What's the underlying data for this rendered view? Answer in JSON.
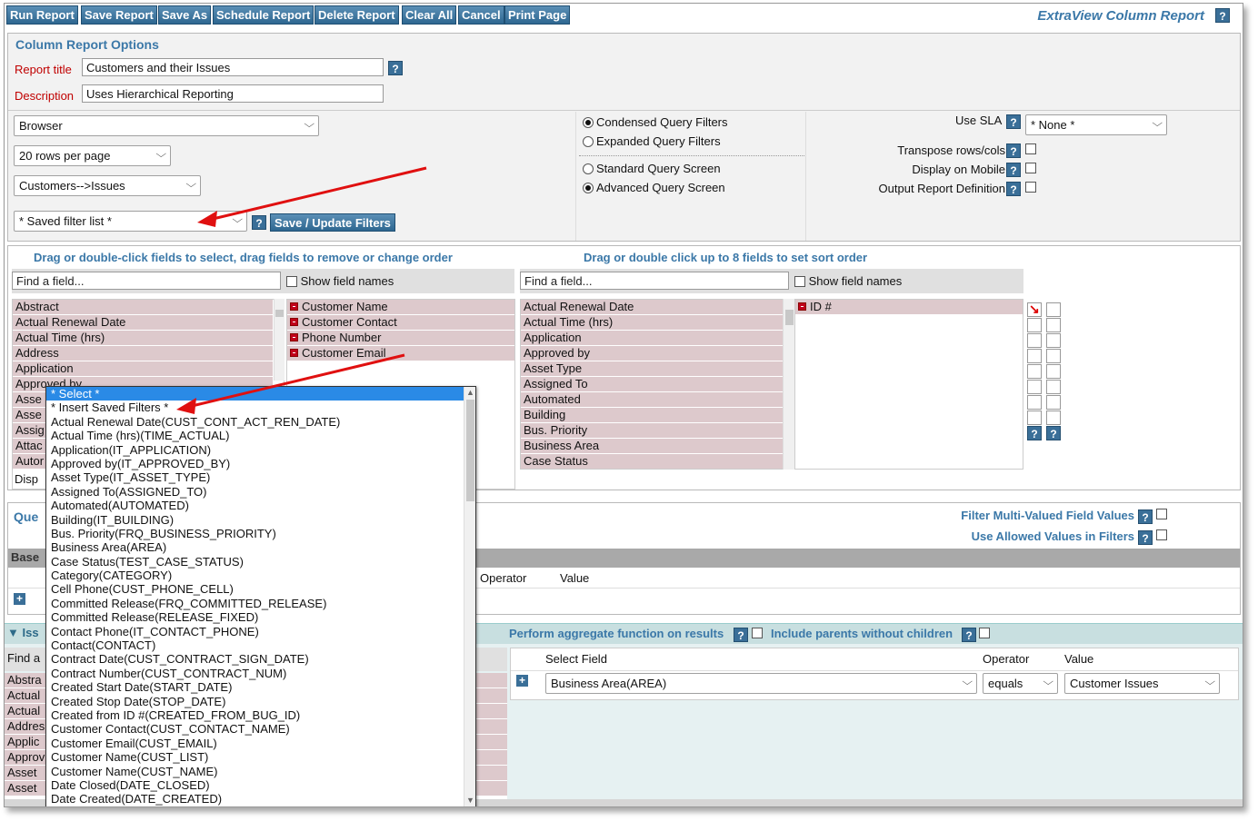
{
  "toolbar": {
    "buttons": [
      "Run Report",
      "Save Report",
      "Save As",
      "Schedule Report",
      "Delete Report",
      "Clear All",
      "Cancel",
      "Print Page"
    ],
    "app_title": "ExtraView Column Report",
    "help": "?"
  },
  "options": {
    "header": "Column Report Options",
    "report_title_label": "Report title",
    "report_title_value": "Customers and their Issues",
    "description_label": "Description",
    "description_value": "Uses Hierarchical Reporting",
    "output_select": "Browser",
    "rows_select": "20 rows per page",
    "hierarchy_select": "Customers-->Issues",
    "saved_filter_select": "* Saved filter list *",
    "save_filters_button": "Save / Update Filters",
    "condensed": "Condensed Query Filters",
    "expanded": "Expanded Query Filters",
    "standard": "Standard Query Screen",
    "advanced": "Advanced Query Screen",
    "use_sla": "Use SLA",
    "sla_value": "* None *",
    "transpose": "Transpose rows/cols",
    "mobile": "Display on Mobile",
    "output_def": "Output Report Definition"
  },
  "fields": {
    "left_head": "Drag or double-click fields to select, drag fields to remove or change order",
    "right_head": "Drag or double click up to 8 fields to set sort order",
    "find_placeholder": "Find a field...",
    "show_names": "Show field names",
    "available": [
      "Abstract",
      "Actual Renewal Date",
      "Actual Time (hrs)",
      "Address",
      "Application",
      "Approved by",
      "Asset Type",
      "Asset Type",
      "Assigned To",
      "Attachments",
      "Automated"
    ],
    "available_trunc": [
      "Abstract",
      "Actual Renewal Date",
      "Actual Time (hrs)",
      "Address",
      "Application",
      "Approved by",
      "Asse",
      "Asse",
      "Assig",
      "Attac",
      "Autor"
    ],
    "display_trunc": "Disp",
    "selected": [
      "Customer Name",
      "Customer Contact",
      "Phone Number",
      "Customer Email"
    ],
    "sort_available": [
      "Actual Renewal Date",
      "Actual Time (hrs)",
      "Application",
      "Approved by",
      "Asset Type",
      "Assigned To",
      "Automated",
      "Building",
      "Bus. Priority",
      "Business Area",
      "Case Status"
    ],
    "sort_selected": [
      "ID #"
    ]
  },
  "query": {
    "que_trunc": "Que",
    "multi_valued": "Filter Multi-Valued Field Values",
    "allowed_values": "Use Allowed Values in Filters",
    "base_trunc": "Base",
    "operator": "Operator",
    "value": "Value"
  },
  "issues": {
    "iss_trunc": "Iss",
    "find_trunc": "Find a",
    "items_trunc": [
      "Abstra",
      "Actual",
      "Actual",
      "Addres",
      "Applic",
      "Approv",
      "Asset",
      "Asset"
    ],
    "aggregate": "Perform aggregate function on results",
    "parents": "Include parents without children",
    "select_field": "Select Field",
    "operator": "Operator",
    "value": "Value",
    "field_value": "Business Area(AREA)",
    "operator_value": "equals",
    "value_value": "Customer Issues"
  },
  "dropdown": {
    "options": [
      "* Select *",
      "* Insert Saved Filters *",
      "Actual Renewal Date(CUST_CONT_ACT_REN_DATE)",
      "Actual Time (hrs)(TIME_ACTUAL)",
      "Application(IT_APPLICATION)",
      "Approved by(IT_APPROVED_BY)",
      "Asset Type(IT_ASSET_TYPE)",
      "Assigned To(ASSIGNED_TO)",
      "Automated(AUTOMATED)",
      "Building(IT_BUILDING)",
      "Bus. Priority(FRQ_BUSINESS_PRIORITY)",
      "Business Area(AREA)",
      "Case Status(TEST_CASE_STATUS)",
      "Category(CATEGORY)",
      "Cell Phone(CUST_PHONE_CELL)",
      "Committed Release(FRQ_COMMITTED_RELEASE)",
      "Committed Release(RELEASE_FIXED)",
      "Contact Phone(IT_CONTACT_PHONE)",
      "Contact(CONTACT)",
      "Contract Date(CUST_CONTRACT_SIGN_DATE)",
      "Contract Number(CUST_CONTRACT_NUM)",
      "Created Start Date(START_DATE)",
      "Created Stop Date(STOP_DATE)",
      "Created from ID #(CREATED_FROM_BUG_ID)",
      "Customer Contact(CUST_CONTACT_NAME)",
      "Customer Email(CUST_EMAIL)",
      "Customer Name(CUST_LIST)",
      "Customer Name(CUST_NAME)",
      "Date Closed(DATE_CLOSED)",
      "Date Created(DATE_CREATED)"
    ]
  }
}
